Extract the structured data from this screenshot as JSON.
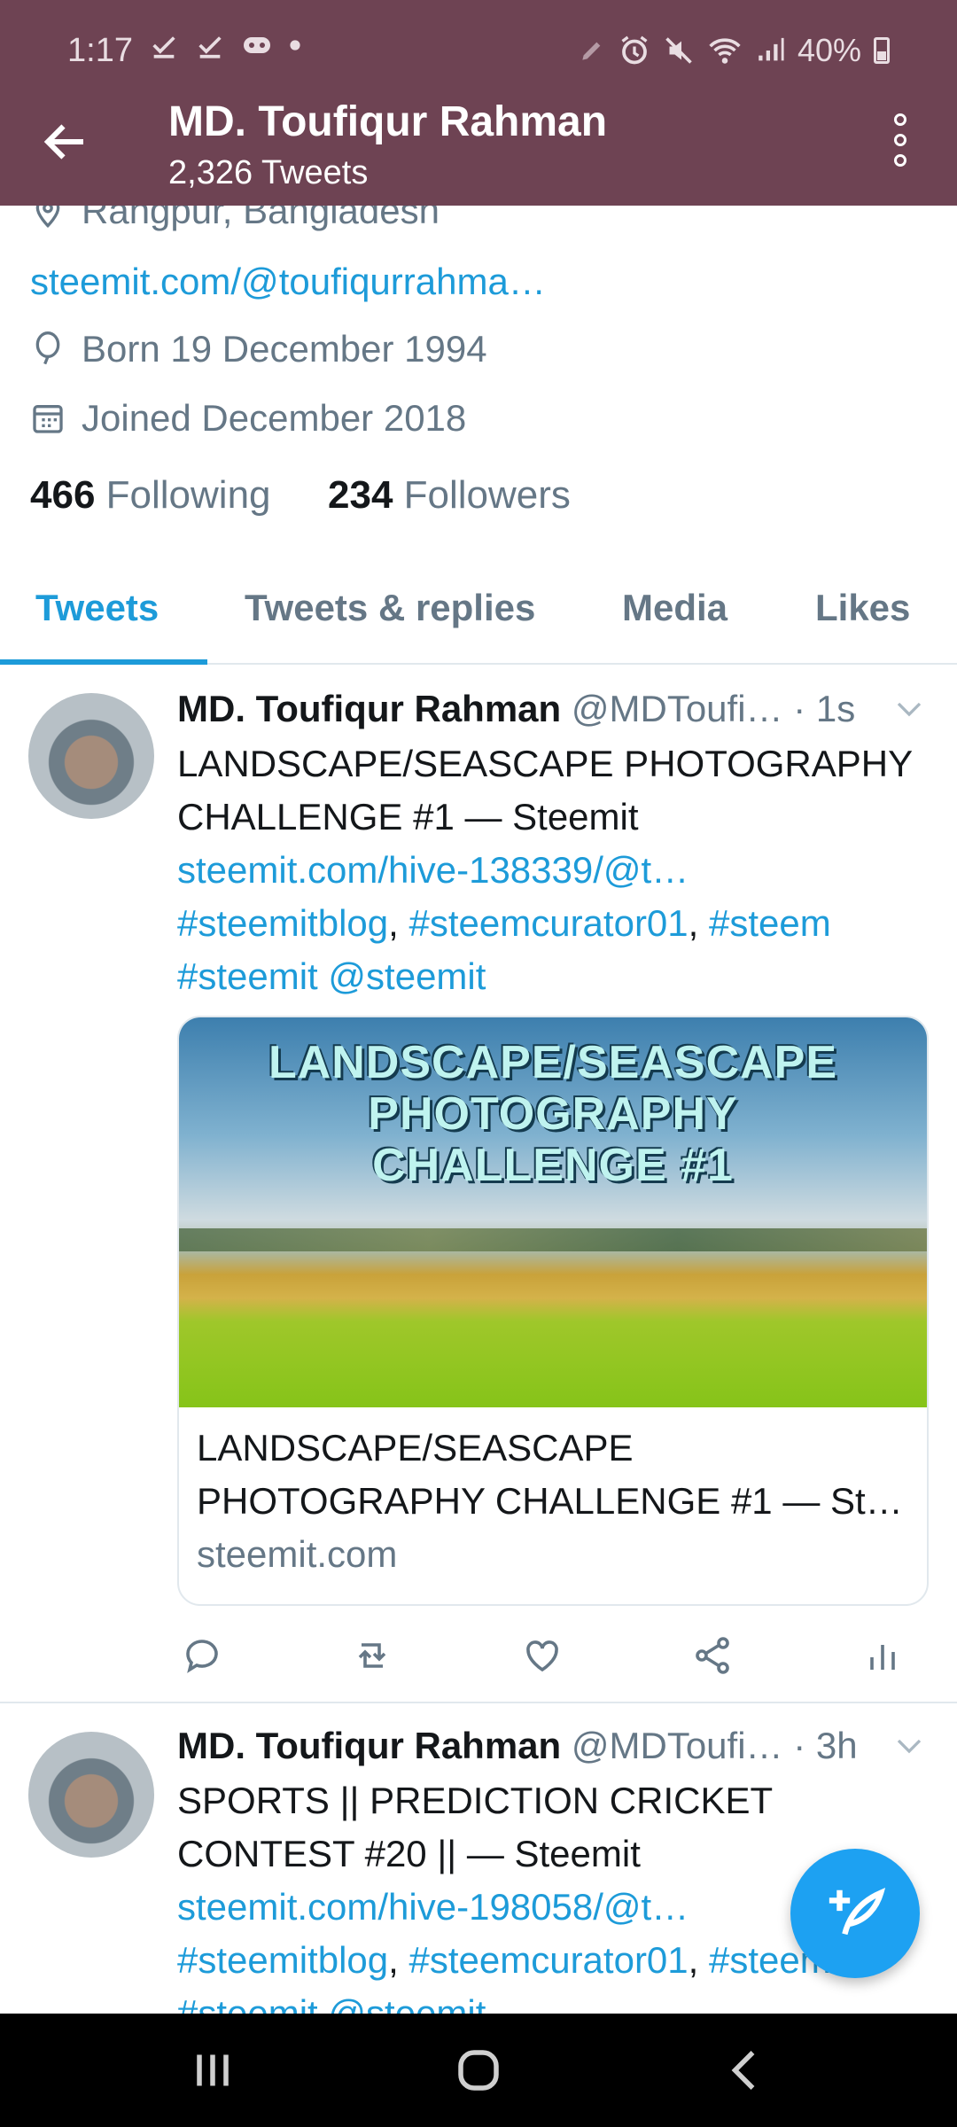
{
  "status_bar": {
    "time": "1:17",
    "battery": "40%"
  },
  "header": {
    "name": "MD. Toufiqur Rahman",
    "tweet_count": "2,326 Tweets"
  },
  "profile": {
    "location": "Rangpur, Bangladesh",
    "website": "steemit.com/@toufiqurrahma…",
    "born": "Born 19 December 1994",
    "joined": "Joined December 2018",
    "following_count": "466",
    "following_label": "Following",
    "followers_count": "234",
    "followers_label": "Followers"
  },
  "tabs": [
    {
      "label": "Tweets"
    },
    {
      "label": "Tweets & replies"
    },
    {
      "label": "Media"
    },
    {
      "label": "Likes"
    }
  ],
  "tweets": [
    {
      "name": "MD. Toufiqur Rahman",
      "handle": "@MDToufi… · 1s",
      "line1": "LANDSCAPE/SEASCAPE PHOTOGRAPHY",
      "line2": "CHALLENGE #1 — Steemit",
      "link": "steemit.com/hive-138339/@t…",
      "tags1a": "#steemitblog",
      "tags1b": "#steemcurator01",
      "tags1c": "#steem",
      "tags2": "#steemit @steemit",
      "card": {
        "image_line1": "LANDSCAPE/SEASCAPE",
        "image_line2": "PHOTOGRAPHY",
        "image_line3": "CHALLENGE #1",
        "title_line1": "LANDSCAPE/SEASCAPE",
        "title_line2": "PHOTOGRAPHY CHALLENGE #1 — St…",
        "domain": "steemit.com"
      }
    },
    {
      "name": "MD. Toufiqur Rahman",
      "handle": "@MDToufi… · 3h",
      "line1": "SPORTS || PREDICTION CRICKET",
      "line2": "CONTEST #20 || — Steemit",
      "link": "steemit.com/hive-198058/@t…",
      "tags1a": "#steemitblog",
      "tags1b": "#steemcurator01",
      "tags1c": "#steem",
      "tags2": "#steemit @steemit"
    }
  ],
  "colors": {
    "header_bg": "#6e4353",
    "accent": "#1d9bd9"
  }
}
